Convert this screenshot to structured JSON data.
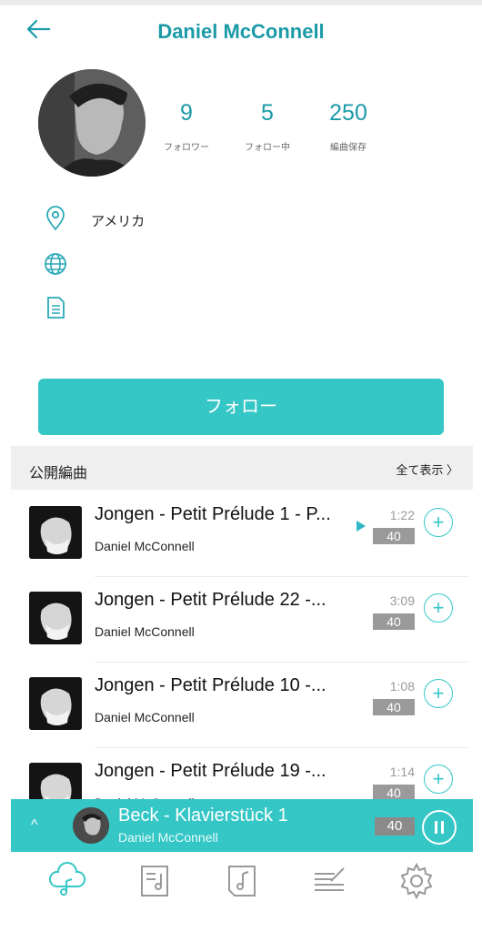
{
  "header": {
    "title": "Daniel McConnell",
    "back_icon": "arrow-left-icon"
  },
  "profile": {
    "stats": [
      {
        "value": "9",
        "label": "フォロワー"
      },
      {
        "value": "5",
        "label": "フォロー中"
      },
      {
        "value": "250",
        "label": "編曲保存"
      }
    ],
    "location": "アメリカ",
    "website": "",
    "bio": ""
  },
  "follow_button": "フォロー",
  "section": {
    "title": "公開編曲",
    "show_all": "全て表示 〉"
  },
  "songs": [
    {
      "title": "Jongen - Petit Prélude 1 - P...",
      "author": "Daniel McConnell",
      "duration": "1:22",
      "badge": "40"
    },
    {
      "title": "Jongen - Petit Prélude 22 -...",
      "author": "Daniel McConnell",
      "duration": "3:09",
      "badge": "40"
    },
    {
      "title": "Jongen - Petit Prélude 10 -...",
      "author": "Daniel McConnell",
      "duration": "1:08",
      "badge": "40"
    },
    {
      "title": "Jongen - Petit Prélude 19 -...",
      "author": "Daniel McConnell",
      "duration": "1:14",
      "badge": "40"
    }
  ],
  "player": {
    "title": "Beck - Klavierstück 1",
    "author": "Daniel McConnell",
    "badge": "40",
    "chevron": "^"
  },
  "tabs": [
    "cloud-music-icon",
    "sheet-music-icon",
    "music-note-icon",
    "edit-score-icon",
    "settings-gear-icon"
  ],
  "colors": {
    "accent": "#35c6c6",
    "title": "#1b9aa8",
    "badge": "#9a9a9a"
  }
}
